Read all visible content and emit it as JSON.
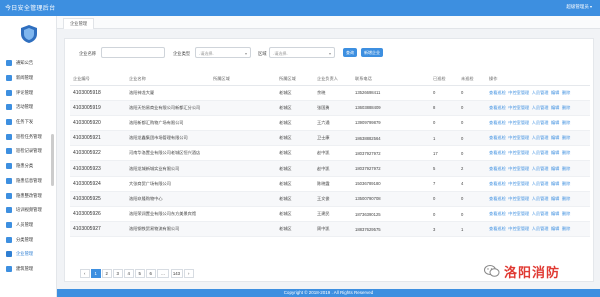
{
  "header": {
    "title": "今日安全管理后台",
    "user": "超级管理员"
  },
  "sidebar": {
    "items": [
      {
        "label": "通知公告"
      },
      {
        "label": "新闻管理"
      },
      {
        "label": "评论管理"
      },
      {
        "label": "活动管理"
      },
      {
        "label": "任务下发"
      },
      {
        "label": "巡检任务管理"
      },
      {
        "label": "巡检记录管理"
      },
      {
        "label": "隐患分类"
      },
      {
        "label": "隐患信息管理"
      },
      {
        "label": "隐患整改管理"
      },
      {
        "label": "培训视频管理"
      },
      {
        "label": "人员管理"
      },
      {
        "label": "分类管理"
      },
      {
        "label": "企业管理"
      },
      {
        "label": "建筑管理"
      }
    ],
    "active_index": 13
  },
  "tab": {
    "label": "企业管理"
  },
  "filter": {
    "name_label": "企业名称",
    "type_label": "企业类型",
    "type_placeholder": "-请选择-",
    "area_label": "区域",
    "area_placeholder": "-请选择-",
    "search_button": "查询",
    "add_button": "新增企业"
  },
  "table": {
    "columns": [
      "企业编号",
      "企业名称",
      "所属区域",
      "所属区域",
      "企业负责人",
      "联系电话",
      "已巡检",
      "未巡检",
      "操作"
    ],
    "rows": [
      [
        "41030059​18",
        "洛阳神龙大厦",
        "",
        "老城区",
        "余晓",
        "13526698411",
        "0",
        "0"
      ],
      [
        "41030059​19",
        "洛阳天怡易商业有限公司新都汇分公司",
        "",
        "老城区",
        "张国勇",
        "13603888409",
        "8",
        "0"
      ],
      [
        "41030059​20",
        "洛阳新都汇购物广场有限公司",
        "",
        "老城区",
        "王六通",
        "13909799879",
        "0",
        "0"
      ],
      [
        "41030059​21",
        "洛阳龙鑫集团市场管理有限公司",
        "",
        "老城区",
        "卫士康",
        "18638882564",
        "1",
        "0"
      ],
      [
        "41030059​22",
        "河南华洛置业有限公司老城区恒兴酒店",
        "",
        "老城区",
        "赵中凯",
        "18037927972",
        "17",
        "0"
      ],
      [
        "41030059​23",
        "洛阳龙城新城实业有限公司",
        "",
        "老城区",
        "赵中凯",
        "18037927972",
        "5",
        "2"
      ],
      [
        "41030059​24",
        "大张商贸广场有限公司",
        "",
        "老城区",
        "陈晓霞",
        "15036789180",
        "7",
        "4"
      ],
      [
        "41030059​25",
        "洛阳玖隆购物中心",
        "",
        "老城区",
        "王文俊",
        "13500790708",
        "0",
        "0"
      ],
      [
        "41030059​26",
        "洛阳荣润置业有限公司东方美景宾馆",
        "",
        "老城区",
        "王建民",
        "18736390125",
        "0",
        "0"
      ],
      [
        "41030059​27",
        "洛阳钢铁贸易物流有限公司",
        "",
        "老城区",
        "周中凯",
        "18837629575",
        "3",
        "1"
      ]
    ],
    "action_labels": [
      "查看巡检",
      "中控室管理",
      "人员管理",
      "编辑",
      "删除"
    ]
  },
  "pagination": {
    "pages": [
      "‹",
      "1",
      "2",
      "3",
      "4",
      "5",
      "6",
      "...",
      "143",
      "›"
    ],
    "active": "1"
  },
  "footer": {
    "text": "Copyright © 2018-2019 . All Rights Reserved"
  },
  "watermark": {
    "text": "洛阳消防"
  },
  "colors": {
    "primary": "#3d8fe0",
    "watermark": "#e03a33"
  }
}
